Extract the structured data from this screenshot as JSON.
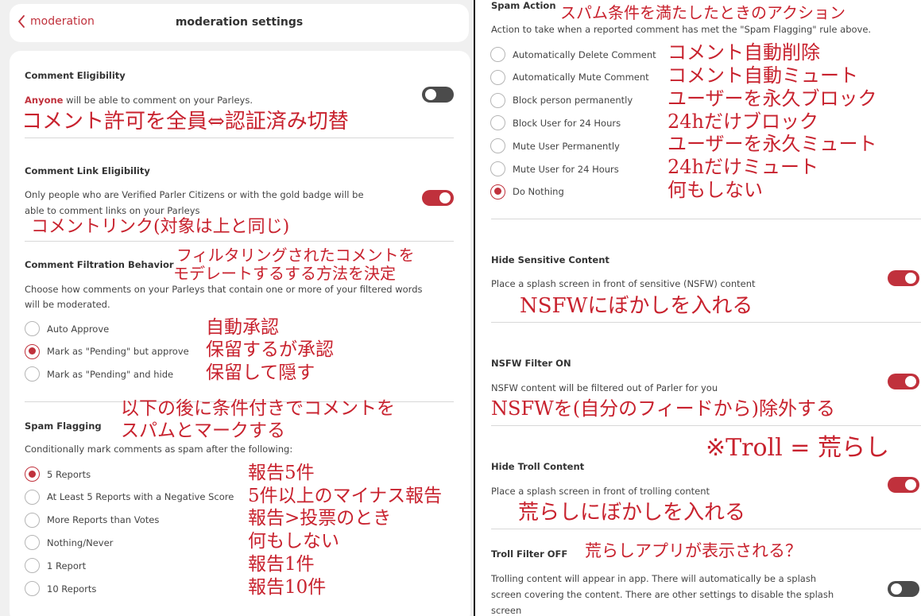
{
  "header": {
    "back_label": "moderation",
    "title": "moderation settings"
  },
  "comment_eligibility": {
    "title": "Comment Eligibility",
    "desc_highlight": "Anyone",
    "desc_rest": " will be able to comment on your Parleys.",
    "toggle": "off",
    "note": "コメント許可を全員⇔認証済み切替"
  },
  "comment_link": {
    "title": "Comment Link Eligibility",
    "desc_1": "Only people who are Verified Parler Citizens or with the gold badge will be",
    "desc_2": "able to comment links on your Parleys",
    "toggle": "on",
    "note": "コメントリンク(対象は上と同じ)"
  },
  "filtration": {
    "title": "Comment Filtration Behavior",
    "note_1": "フィルタリングされたコメントを",
    "note_2": "モデレートするする方法を決定",
    "desc_1": "Choose how comments on your Parleys that contain one or more of your filtered words",
    "desc_2": "will be moderated.",
    "options": [
      {
        "label": "Auto Approve",
        "note": "自動承認",
        "selected": false
      },
      {
        "label": "Mark as \"Pending\" but approve",
        "note": "保留するが承認",
        "selected": true
      },
      {
        "label": "Mark as \"Pending\" and hide",
        "note": "保留して隠す",
        "selected": false
      }
    ]
  },
  "spam_flagging": {
    "title": "Spam Flagging",
    "note_1": "以下の後に条件付きでコメントを",
    "note_2": "スパムとマークする",
    "desc": "Conditionally mark comments as spam after the following:",
    "options": [
      {
        "label": "5 Reports",
        "note": "報告5件",
        "selected": true
      },
      {
        "label": "At Least 5 Reports with a Negative Score",
        "note": "5件以上のマイナス報告",
        "selected": false
      },
      {
        "label": "More Reports than Votes",
        "note": "報告>投票のとき",
        "selected": false
      },
      {
        "label": "Nothing/Never",
        "note": "何もしない",
        "selected": false
      },
      {
        "label": "1 Report",
        "note": "報告1件",
        "selected": false
      },
      {
        "label": "10 Reports",
        "note": "報告10件",
        "selected": false
      }
    ]
  },
  "spam_action": {
    "title": "Spam Action",
    "note": "スパム条件を満たしたときのアクション",
    "desc": "Action to take when a reported comment has met the \"Spam Flagging\" rule above.",
    "options": [
      {
        "label": "Automatically Delete Comment",
        "note": "コメント自動削除",
        "selected": false
      },
      {
        "label": "Automatically Mute Comment",
        "note": "コメント自動ミュート",
        "selected": false
      },
      {
        "label": "Block person permanently",
        "note": "ユーザーを永久ブロック",
        "selected": false
      },
      {
        "label": "Block User for 24 Hours",
        "note": "24hだけブロック",
        "selected": false
      },
      {
        "label": "Mute User Permanently",
        "note": "ユーザーを永久ミュート",
        "selected": false
      },
      {
        "label": "Mute User for 24 Hours",
        "note": "24hだけミュート",
        "selected": false
      },
      {
        "label": "Do Nothing",
        "note": "何もしない",
        "selected": true
      }
    ]
  },
  "hide_sensitive": {
    "title": "Hide Sensitive Content",
    "desc": "Place a splash screen in front of sensitive (NSFW) content",
    "toggle": "on",
    "note": "NSFWにぼかしを入れる"
  },
  "nsfw_filter": {
    "title": "NSFW Filter ON",
    "desc": "NSFW content will be filtered out of Parler for you",
    "toggle": "on",
    "note": "NSFWを(自分のフィードから)除外する"
  },
  "troll_note": "※Troll = 荒らし",
  "hide_troll": {
    "title": "Hide Troll Content",
    "desc": "Place a splash screen in front of trolling content",
    "toggle": "on",
    "note": "荒らしにぼかしを入れる"
  },
  "troll_filter": {
    "title": "Troll Filter OFF",
    "note": "荒らしアプリが表示される？",
    "desc_1": "Trolling content will appear in app. There will automatically be a splash",
    "desc_2": "screen covering the content. There are other settings to disable the splash",
    "desc_3": "screen",
    "toggle": "off"
  },
  "colors": {
    "accent": "#c0313c",
    "annotation": "#c8222e",
    "toggle_off": "#4b4b4b"
  }
}
